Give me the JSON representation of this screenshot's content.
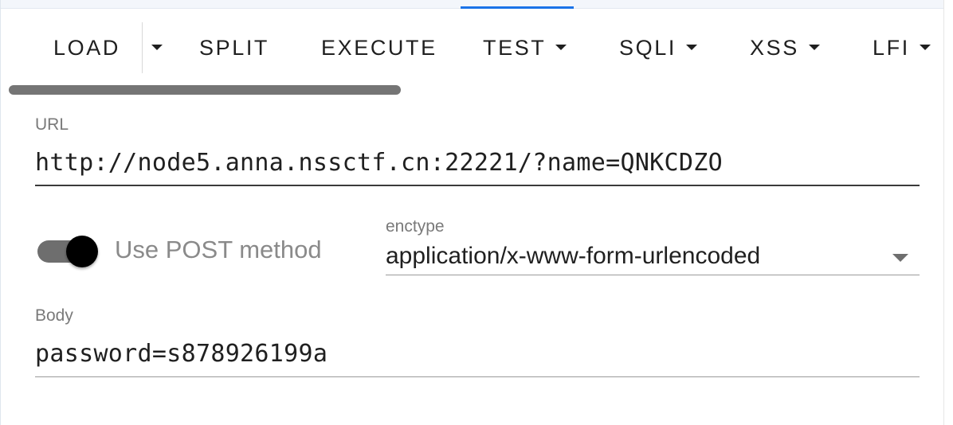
{
  "toolbar": {
    "load_label": "LOAD",
    "split_label": "SPLIT",
    "execute_label": "EXECUTE",
    "test_label": "TEST",
    "sqli_label": "SQLI",
    "xss_label": "XSS",
    "lfi_label": "LFI"
  },
  "url": {
    "label": "URL",
    "value": "http://node5.anna.nssctf.cn:22221/?name=QNKCDZO"
  },
  "post_toggle": {
    "label": "Use POST method",
    "checked": true
  },
  "enctype": {
    "label": "enctype",
    "value": "application/x-www-form-urlencoded"
  },
  "body": {
    "label": "Body",
    "value": "password=s878926199a"
  },
  "colors": {
    "accent": "#1a73e8",
    "toggle_knob": "#000000",
    "toggle_track": "#6e6e6e"
  }
}
